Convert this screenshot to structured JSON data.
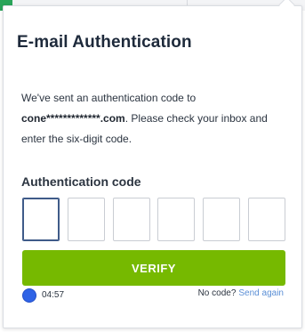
{
  "dialog": {
    "title": "E-mail Authentication",
    "message_part1": "We've sent an authentication code to",
    "masked_email": "cone*************.com",
    "message_part2": ". Please check your inbox and enter the six-digit code.",
    "code_label": "Authentication code",
    "code_boxes": [
      "",
      "",
      "",
      "",
      "",
      ""
    ],
    "verify_label": "VERIFY",
    "timer": "04:57",
    "timer_icon": "clock-icon",
    "no_code_label": "No code?",
    "send_again_label": "Send again"
  },
  "colors": {
    "accent_green": "#76b900",
    "link_blue": "#5b8fd6",
    "timer_blue": "#2f63e6",
    "active_box_border": "#3f5b89"
  }
}
